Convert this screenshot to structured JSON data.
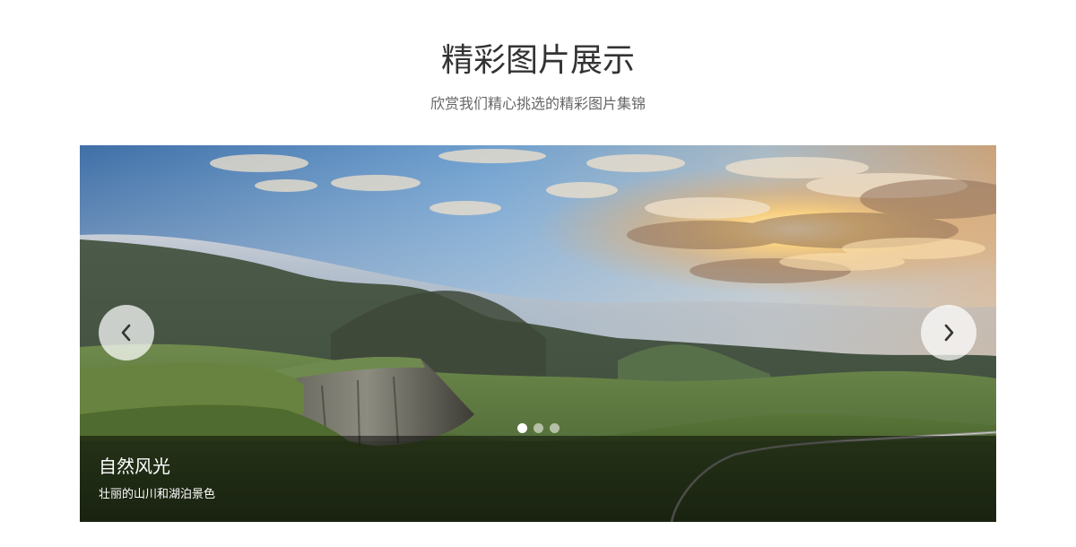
{
  "header": {
    "title": "精彩图片展示",
    "subtitle": "欣赏我们精心挑选的精彩图片集锦"
  },
  "carousel": {
    "prev_icon": "chevron-left-icon",
    "prev_label": "‹",
    "next_icon": "chevron-right-icon",
    "next_label": "›",
    "slide_count": 3,
    "active_index": 0,
    "current_slide": {
      "title": "自然风光",
      "description": "壮丽的山川和湖泊景色"
    }
  },
  "colors": {
    "title": "#333333",
    "subtitle": "#666666",
    "caption_bg": "rgba(0,0,0,0.5)",
    "dot_active": "#ffffff"
  }
}
